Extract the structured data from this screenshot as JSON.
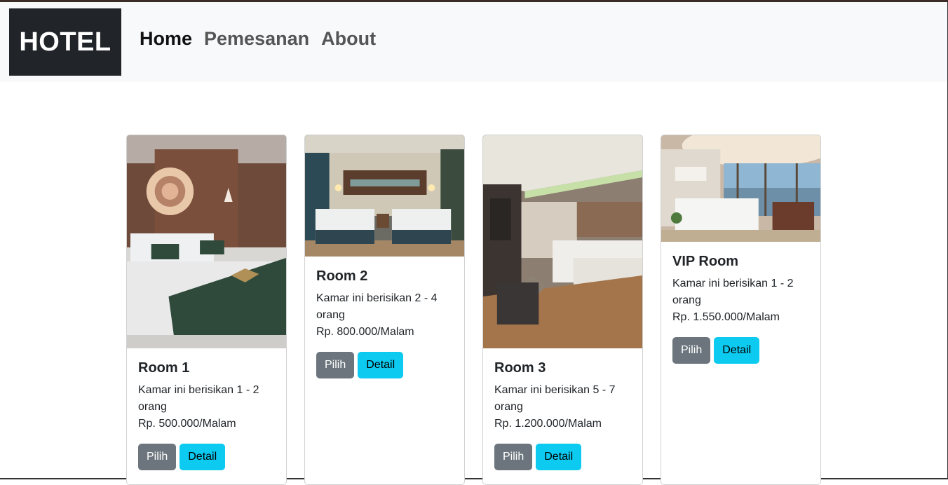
{
  "navbar": {
    "brand": "HOTEL",
    "links": [
      "Home",
      "Pemesanan",
      "About"
    ]
  },
  "rooms": [
    {
      "title": "Room 1",
      "description": "Kamar ini berisikan 1 - 2 orang",
      "price": "Rp. 500.000/Malam",
      "pilih_label": "Pilih",
      "detail_label": "Detail",
      "image": "hotel-room-photo"
    },
    {
      "title": "Room 2",
      "description": "Kamar ini berisikan 2 - 4 orang",
      "price": "Rp. 800.000/Malam",
      "pilih_label": "Pilih",
      "detail_label": "Detail",
      "image": "hotel-room-photo"
    },
    {
      "title": "Room 3",
      "description": "Kamar ini berisikan 5 - 7 orang",
      "price": "Rp. 1.200.000/Malam",
      "pilih_label": "Pilih",
      "detail_label": "Detail",
      "image": "hotel-room-photo"
    },
    {
      "title": "VIP Room",
      "description": "Kamar ini berisikan 1 - 2 orang",
      "price": "Rp. 1.550.000/Malam",
      "pilih_label": "Pilih",
      "detail_label": "Detail",
      "image": "hotel-room-photo"
    }
  ],
  "colors": {
    "navbar_bg": "#f8f9fa",
    "brand_bg": "#212529",
    "pilih_button": "#6c757d",
    "detail_button": "#0dcaf0"
  }
}
